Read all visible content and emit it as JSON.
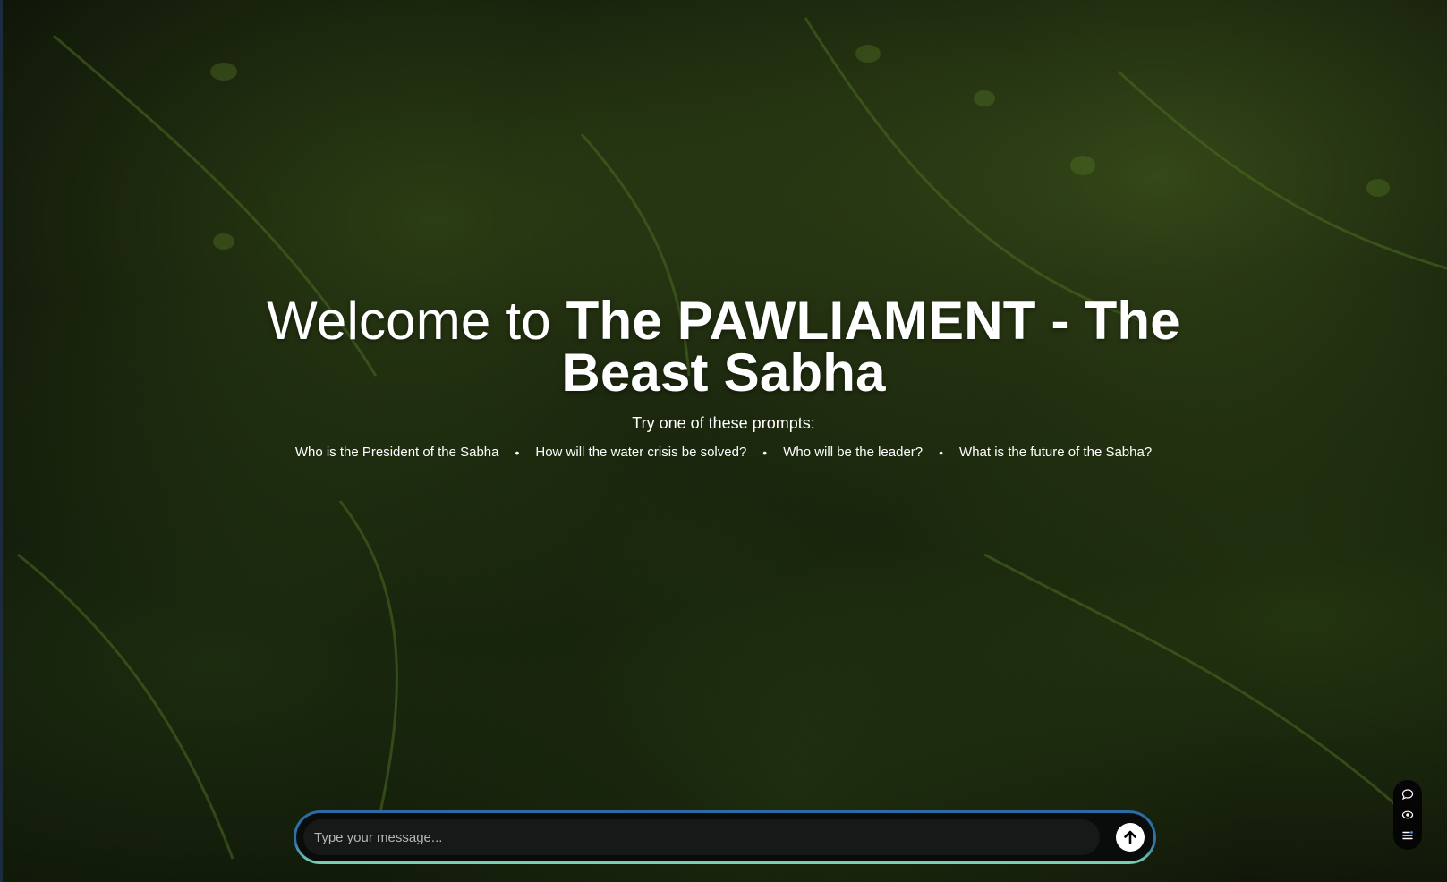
{
  "hero": {
    "title_prefix": "Welcome to ",
    "title_bold": "The PAWLIAMENT - The Beast Sabha",
    "prompt_heading": "Try one of these prompts:",
    "prompts": [
      "Who is the President of the Sabha",
      "How will the water crisis be solved?",
      "Who will be the leader?",
      "What is the future of the Sabha?"
    ],
    "separator": "•"
  },
  "composer": {
    "placeholder": "Type your message...",
    "send_icon": "arrow-up-icon",
    "border_colors": [
      "#2c6aa3",
      "#7ed3b5"
    ]
  },
  "side_tools": {
    "icons": [
      "chat-bubble-icon",
      "eye-icon",
      "list-icon"
    ]
  },
  "colors": {
    "background_dark": "#0b0f07",
    "text": "#ffffff"
  }
}
